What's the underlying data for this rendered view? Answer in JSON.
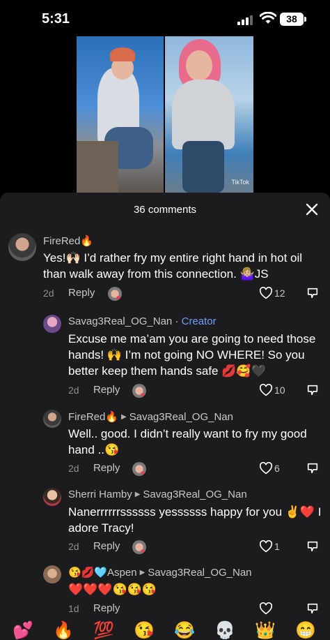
{
  "status_bar": {
    "time": "5:31",
    "battery": "38"
  },
  "video": {
    "watermark": "TikTok"
  },
  "sheet": {
    "title": "36 comments"
  },
  "comments": [
    {
      "user": "FireRed🔥",
      "text": "Yes!🙌🏻 I’d rather fry my entire right hand in hot oil than walk away from this connection. 🤷🏼‍♀️JS",
      "age": "2d",
      "reply": "Reply",
      "likes": "12"
    },
    {
      "user": "Savag3Real_OG_Nan",
      "separator": " · ",
      "badge": "Creator",
      "text": "Excuse me ma’am you are going to need those hands! 🙌 I’m not going NO WHERE! So you better keep them hands safe 💋🥰🖤",
      "age": "2d",
      "reply": "Reply",
      "likes": "10"
    },
    {
      "user": "FireRed🔥",
      "reply_to": "Savag3Real_OG_Nan",
      "text": "Well.. good. I didn’t really want to fry my good hand ..😘",
      "age": "2d",
      "reply": "Reply",
      "likes": "6"
    },
    {
      "user": "Sherri Hamby",
      "reply_to": "Savag3Real_OG_Nan",
      "text": "Nanerrrrrrssssss yessssss happy for you ✌️❤️ I adore Tracy!",
      "age": "2d",
      "reply": "Reply",
      "likes": "1"
    },
    {
      "user": "😘💋🩵Aspen",
      "reply_to": "Savag3Real_OG_Nan",
      "text": "❤️❤️❤️😘😘😘",
      "age": "1d",
      "reply": "Reply",
      "likes": ""
    }
  ],
  "emoji_bar": [
    "💕",
    "🔥",
    "💯",
    "😘",
    "😂",
    "💀",
    "👑",
    "😁"
  ],
  "colors": {
    "sheet_bg": "#1c1c1e",
    "creator": "#6aa0ff",
    "heart": "#ff2d55"
  }
}
